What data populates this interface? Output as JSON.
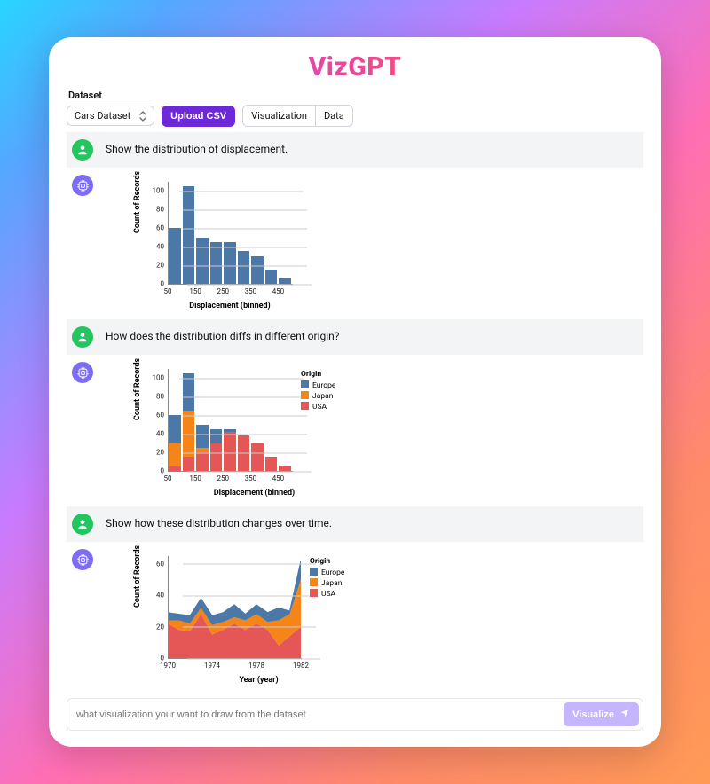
{
  "app": {
    "title": "VizGPT"
  },
  "toolbar": {
    "dataset_label": "Dataset",
    "dataset_value": "Cars Dataset",
    "upload_label": "Upload CSV",
    "tabs": {
      "visualization": "Visualization",
      "data": "Data"
    }
  },
  "messages": [
    {
      "role": "user",
      "text": "Show the distribution of displacement."
    },
    {
      "role": "bot",
      "chart": 0
    },
    {
      "role": "user",
      "text": "How does the distribution diffs in different origin?"
    },
    {
      "role": "bot",
      "chart": 1
    },
    {
      "role": "user",
      "text": "Show how these distribution changes over time."
    },
    {
      "role": "bot",
      "chart": 2
    }
  ],
  "input": {
    "placeholder": "what visualization your want to draw from the dataset",
    "button": "Visualize"
  },
  "legend_title": "Origin",
  "legend_items": [
    {
      "name": "Europe",
      "color": "#4c78a8"
    },
    {
      "name": "Japan",
      "color": "#f58518"
    },
    {
      "name": "USA",
      "color": "#e45756"
    }
  ],
  "chart_data": [
    {
      "type": "bar",
      "title": "",
      "xlabel": "Displacement (binned)",
      "ylabel": "Count of Records",
      "xticks": [
        50,
        150,
        250,
        350,
        450
      ],
      "yticks": [
        0,
        20,
        40,
        60,
        80,
        100
      ],
      "xbinstep": 50,
      "ylim": [
        0,
        110
      ],
      "categories": [
        50,
        100,
        150,
        200,
        250,
        300,
        350,
        400,
        450
      ],
      "values": [
        60,
        105,
        50,
        45,
        45,
        35,
        30,
        15,
        6
      ]
    },
    {
      "type": "bar-stacked",
      "title": "",
      "xlabel": "Displacement (binned)",
      "ylabel": "Count of Records",
      "xticks": [
        50,
        150,
        250,
        350,
        450
      ],
      "yticks": [
        0,
        20,
        40,
        60,
        80,
        100
      ],
      "xbinstep": 50,
      "ylim": [
        0,
        110
      ],
      "categories": [
        50,
        100,
        150,
        200,
        250,
        300,
        350,
        400,
        450
      ],
      "series": [
        {
          "name": "USA",
          "color": "#e45756",
          "values": [
            5,
            15,
            20,
            30,
            42,
            38,
            30,
            15,
            6
          ]
        },
        {
          "name": "Japan",
          "color": "#f58518",
          "values": [
            25,
            50,
            5,
            0,
            0,
            0,
            0,
            0,
            0
          ]
        },
        {
          "name": "Europe",
          "color": "#4c78a8",
          "values": [
            30,
            40,
            25,
            15,
            3,
            0,
            0,
            0,
            0
          ]
        }
      ]
    },
    {
      "type": "area-stacked",
      "title": "",
      "xlabel": "Year (year)",
      "ylabel": "Count of Records",
      "xticks": [
        1970,
        1974,
        1978,
        1982
      ],
      "yticks": [
        0,
        20,
        40,
        60
      ],
      "ylim": [
        0,
        65
      ],
      "x": [
        1970,
        1971,
        1972,
        1973,
        1974,
        1975,
        1976,
        1977,
        1978,
        1979,
        1980,
        1981,
        1982
      ],
      "series": [
        {
          "name": "USA",
          "color": "#e45756",
          "values": [
            22,
            18,
            17,
            28,
            15,
            18,
            22,
            18,
            22,
            18,
            8,
            14,
            20
          ]
        },
        {
          "name": "Japan",
          "color": "#f58518",
          "values": [
            2,
            6,
            5,
            4,
            6,
            5,
            4,
            6,
            6,
            5,
            16,
            14,
            30
          ]
        },
        {
          "name": "Europe",
          "color": "#4c78a8",
          "values": [
            5,
            4,
            5,
            6,
            6,
            6,
            8,
            4,
            6,
            6,
            8,
            2,
            12
          ]
        }
      ]
    }
  ]
}
